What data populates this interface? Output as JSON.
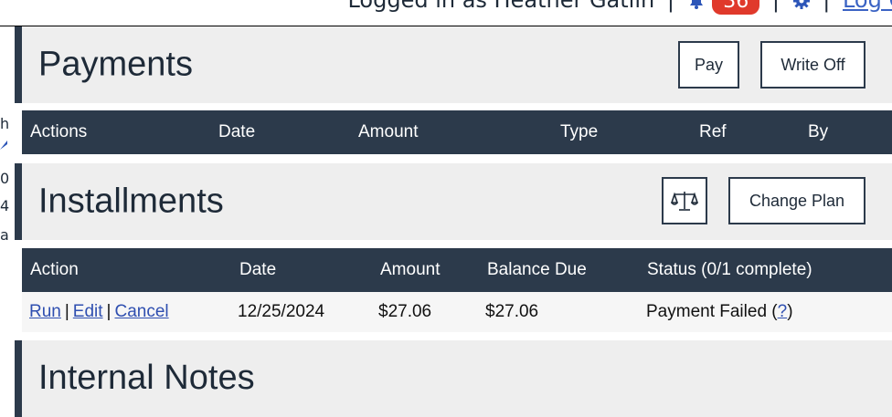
{
  "header": {
    "login_text": "Logged in as Heather Gatlin",
    "separator": "|",
    "notification_count": "36",
    "logout_label": "Log Out",
    "badge_color": "#e0392b"
  },
  "left_clip": [
    "h",
    "0",
    "4",
    "a"
  ],
  "payments": {
    "title": "Payments",
    "pay_label": "Pay",
    "writeoff_label": "Write Off",
    "columns": [
      "Actions",
      "Date",
      "Amount",
      "Type",
      "Ref",
      "By"
    ]
  },
  "installments": {
    "title": "Installments",
    "change_plan_label": "Change Plan",
    "balance_icon": "balance-scale-icon",
    "columns": [
      "Action",
      "Date",
      "Amount",
      "Balance Due",
      "Status (0/1 complete)"
    ],
    "rows": [
      {
        "run": "Run",
        "edit": "Edit",
        "cancel": "Cancel",
        "date": "12/25/2024",
        "amount": "$27.06",
        "balance_due": "$27.06",
        "status": "Payment Failed (",
        "status_help": "?",
        "status_end": ")"
      }
    ]
  },
  "notes": {
    "title": "Internal Notes"
  }
}
